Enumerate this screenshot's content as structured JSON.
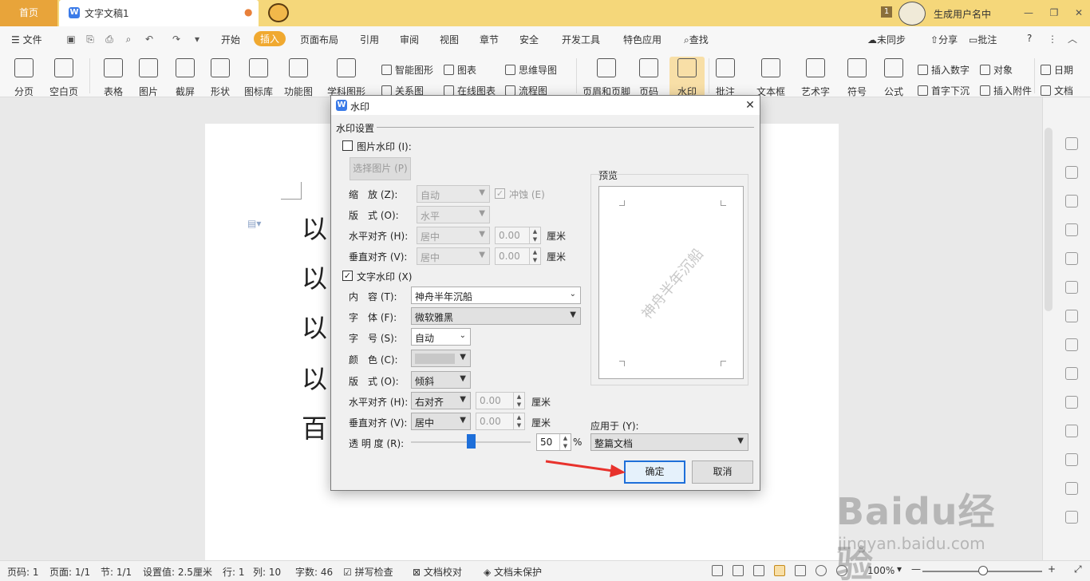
{
  "titlebar": {
    "home_tab": "首页",
    "doc_tab": "文字文稿1",
    "user_badge": "1",
    "user_name": "生成用户名中"
  },
  "menu": {
    "file": "文件",
    "items": [
      "开始",
      "插入",
      "页面布局",
      "引用",
      "审阅",
      "视图",
      "章节",
      "安全",
      "开发工具",
      "特色应用"
    ],
    "active": "插入",
    "search": "查找",
    "sync": "未同步",
    "share": "分享",
    "comment": "批注",
    "help": "?"
  },
  "ribbon": {
    "page_break": "分页",
    "blank_page": "空白页",
    "table": "表格",
    "picture": "图片",
    "screenshot": "截屏",
    "shape": "形状",
    "icon_lib": "图标库",
    "func_chart": "功能图",
    "smart_shape": "智能图形",
    "chart": "图表",
    "mind_map": "思维导图",
    "subject_shape": "学科图形",
    "relation": "关系图",
    "online_chart": "在线图表",
    "flow_chart": "流程图",
    "header_footer": "页眉和页脚",
    "page_num": "页码",
    "watermark": "水印",
    "comment": "批注",
    "textbox": "文本框",
    "art_text": "艺术字",
    "symbol": "符号",
    "formula": "公式",
    "insert_number": "插入数字",
    "object": "对象",
    "date": "日期",
    "drop_cap": "首字下沉",
    "attachment": "插入附件",
    "doc_part": "文档"
  },
  "document": {
    "lines": [
      "以",
      "以",
      "以",
      "以",
      "百"
    ]
  },
  "dialog": {
    "title": "水印",
    "section": "水印设置",
    "pic_watermark": "图片水印 (I):",
    "select_pic": "选择图片 (P)",
    "scale_label": "缩　放 (Z):",
    "scale_value": "自动",
    "washout": "冲蚀 (E)",
    "pic_layout_label": "版　式 (O):",
    "pic_layout_value": "水平",
    "pic_halign_label": "水平对齐 (H):",
    "pic_halign_value": "居中",
    "pic_halign_num": "0.00",
    "pic_valign_label": "垂直对齐 (V):",
    "pic_valign_value": "居中",
    "pic_valign_num": "0.00",
    "unit": "厘米",
    "text_watermark": "文字水印 (X)",
    "content_label": "内　容 (T):",
    "content_value": "神舟半年沉船",
    "font_label": "字　体 (F):",
    "font_value": "微软雅黑",
    "size_label": "字　号 (S):",
    "size_value": "自动",
    "color_label": "颜　色 (C):",
    "text_layout_label": "版　式 (O):",
    "text_layout_value": "倾斜",
    "text_halign_label": "水平对齐 (H):",
    "text_halign_value": "右对齐",
    "text_halign_num": "0.00",
    "text_valign_label": "垂直对齐 (V):",
    "text_valign_value": "居中",
    "text_valign_num": "0.00",
    "transparency_label": "透 明 度 (R):",
    "transparency_value": "50",
    "transparency_fraction": 0.5,
    "percent": "%",
    "preview_label": "预览",
    "preview_text": "神舟半年沉船",
    "apply_label": "应用于 (Y):",
    "apply_value": "整篇文档",
    "ok": "确定",
    "cancel": "取消"
  },
  "statusbar": {
    "page": "页码: 1",
    "pages": "页面: 1/1",
    "section": "节: 1/1",
    "setting": "设置值: 2.5厘米",
    "row": "行: 1",
    "col": "列: 10",
    "words": "字数: 46",
    "spell": "拼写检查",
    "proof": "文档校对",
    "protect": "文档未保护",
    "zoom": "100%"
  },
  "watermark_overlay": {
    "brand": "Baidu经验",
    "url": "jingyan.baidu.com"
  },
  "colors": {
    "accent": "#f0a930",
    "titlebar": "#f5d77a",
    "primary_blue": "#1e6fd9",
    "arrow_red": "#e8322c"
  }
}
